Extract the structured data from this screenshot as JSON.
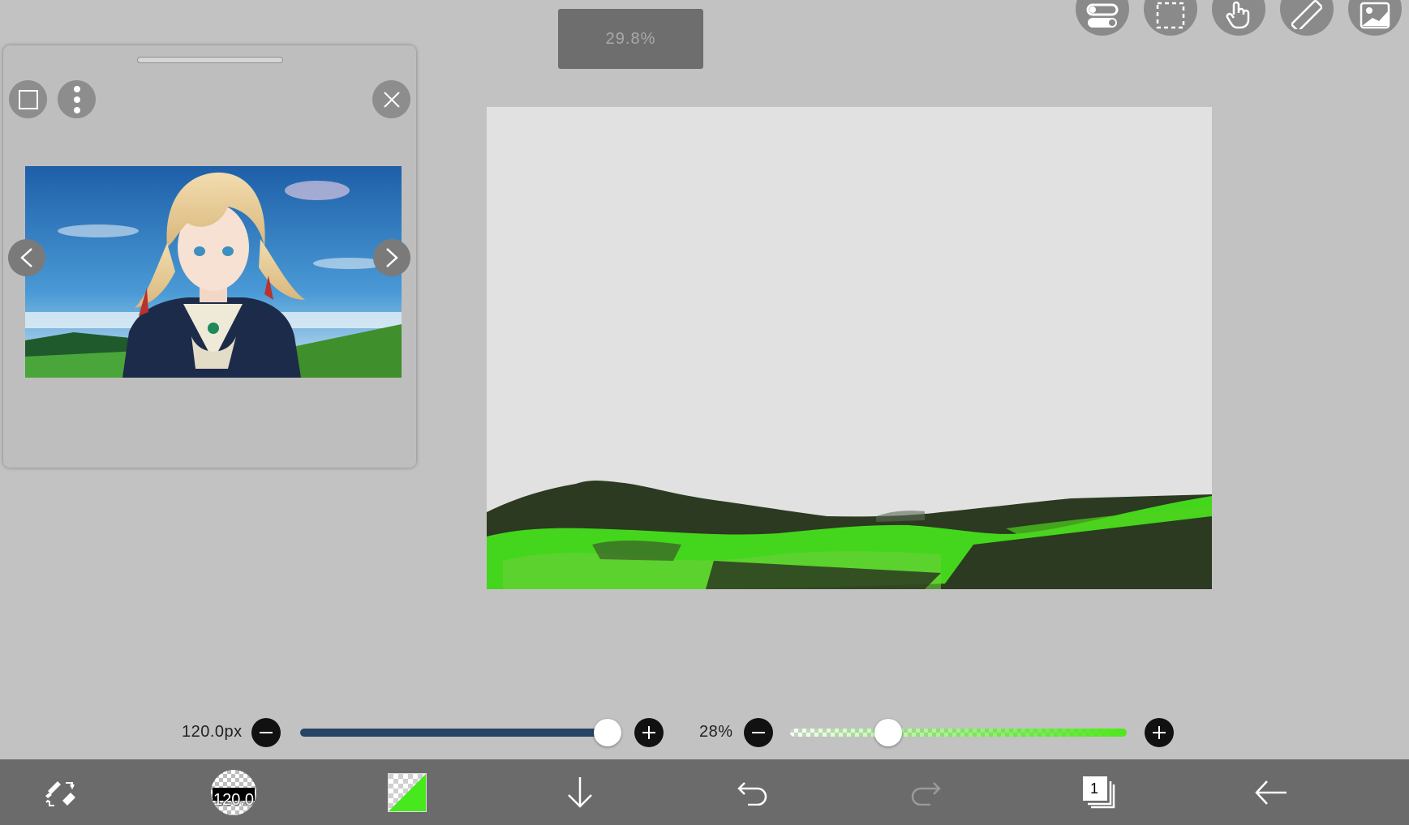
{
  "zoom_label": "29.8%",
  "top_tools": [
    "toggle-settings-icon",
    "selection-icon",
    "hand-icon",
    "ruler-icon",
    "image-icon"
  ],
  "reference_panel": {
    "icons": [
      "square-icon",
      "more-vertical-icon",
      "close-icon",
      "chevron-left-icon",
      "chevron-right-icon"
    ],
    "image_alt": "Violet Evergarden reference image"
  },
  "brush_size": {
    "label": "120.0px",
    "value_fraction": 0.92
  },
  "brush_opacity": {
    "label": "28%",
    "value_fraction": 0.28
  },
  "colors": {
    "background": "#c2c2c2",
    "canvas": "#e1e1e1",
    "toolbar": "#6b6b6b",
    "size_track": "#254466",
    "brush_color": "#47e81c",
    "dark_green": "#2b3a20"
  },
  "toolbar": {
    "brush_size_label": "120.0",
    "layer_count": "1",
    "icons": [
      "brush-eraser-swap-icon",
      "brush-size-icon",
      "color-icon",
      "download-icon",
      "undo-icon",
      "redo-icon",
      "layers-icon",
      "back-icon"
    ]
  }
}
